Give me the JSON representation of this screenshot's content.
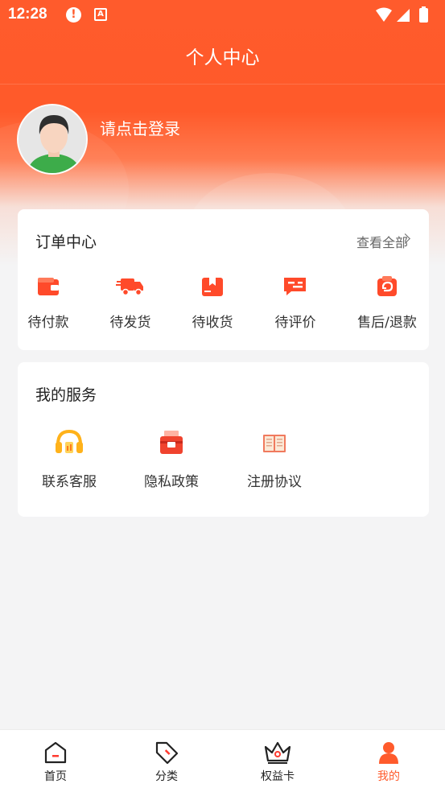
{
  "status_bar": {
    "time": "12:28",
    "alert_glyph": "!",
    "app_icon_glyph": "A"
  },
  "header": {
    "title": "个人中心"
  },
  "profile": {
    "login_prompt": "请点击登录"
  },
  "orders": {
    "title": "订单中心",
    "view_all": "查看全部",
    "items": [
      {
        "label": "待付款",
        "icon": "wallet-icon"
      },
      {
        "label": "待发货",
        "icon": "truck-icon"
      },
      {
        "label": "待收货",
        "icon": "package-icon"
      },
      {
        "label": "待评价",
        "icon": "comment-icon"
      },
      {
        "label": "售后/退款",
        "icon": "refund-icon"
      }
    ]
  },
  "services": {
    "title": "我的服务",
    "items": [
      {
        "label": "联系客服",
        "icon": "headset-icon"
      },
      {
        "label": "隐私政策",
        "icon": "privacy-box-icon"
      },
      {
        "label": "注册协议",
        "icon": "book-icon"
      }
    ]
  },
  "tabbar": {
    "items": [
      {
        "label": "首页",
        "icon": "home-icon",
        "active": false
      },
      {
        "label": "分类",
        "icon": "tag-icon",
        "active": false
      },
      {
        "label": "权益卡",
        "icon": "crown-icon",
        "active": false
      },
      {
        "label": "我的",
        "icon": "person-icon",
        "active": true
      }
    ]
  },
  "colors": {
    "accent": "#ff5b2c",
    "background": "#f4f4f5",
    "card": "#ffffff"
  }
}
